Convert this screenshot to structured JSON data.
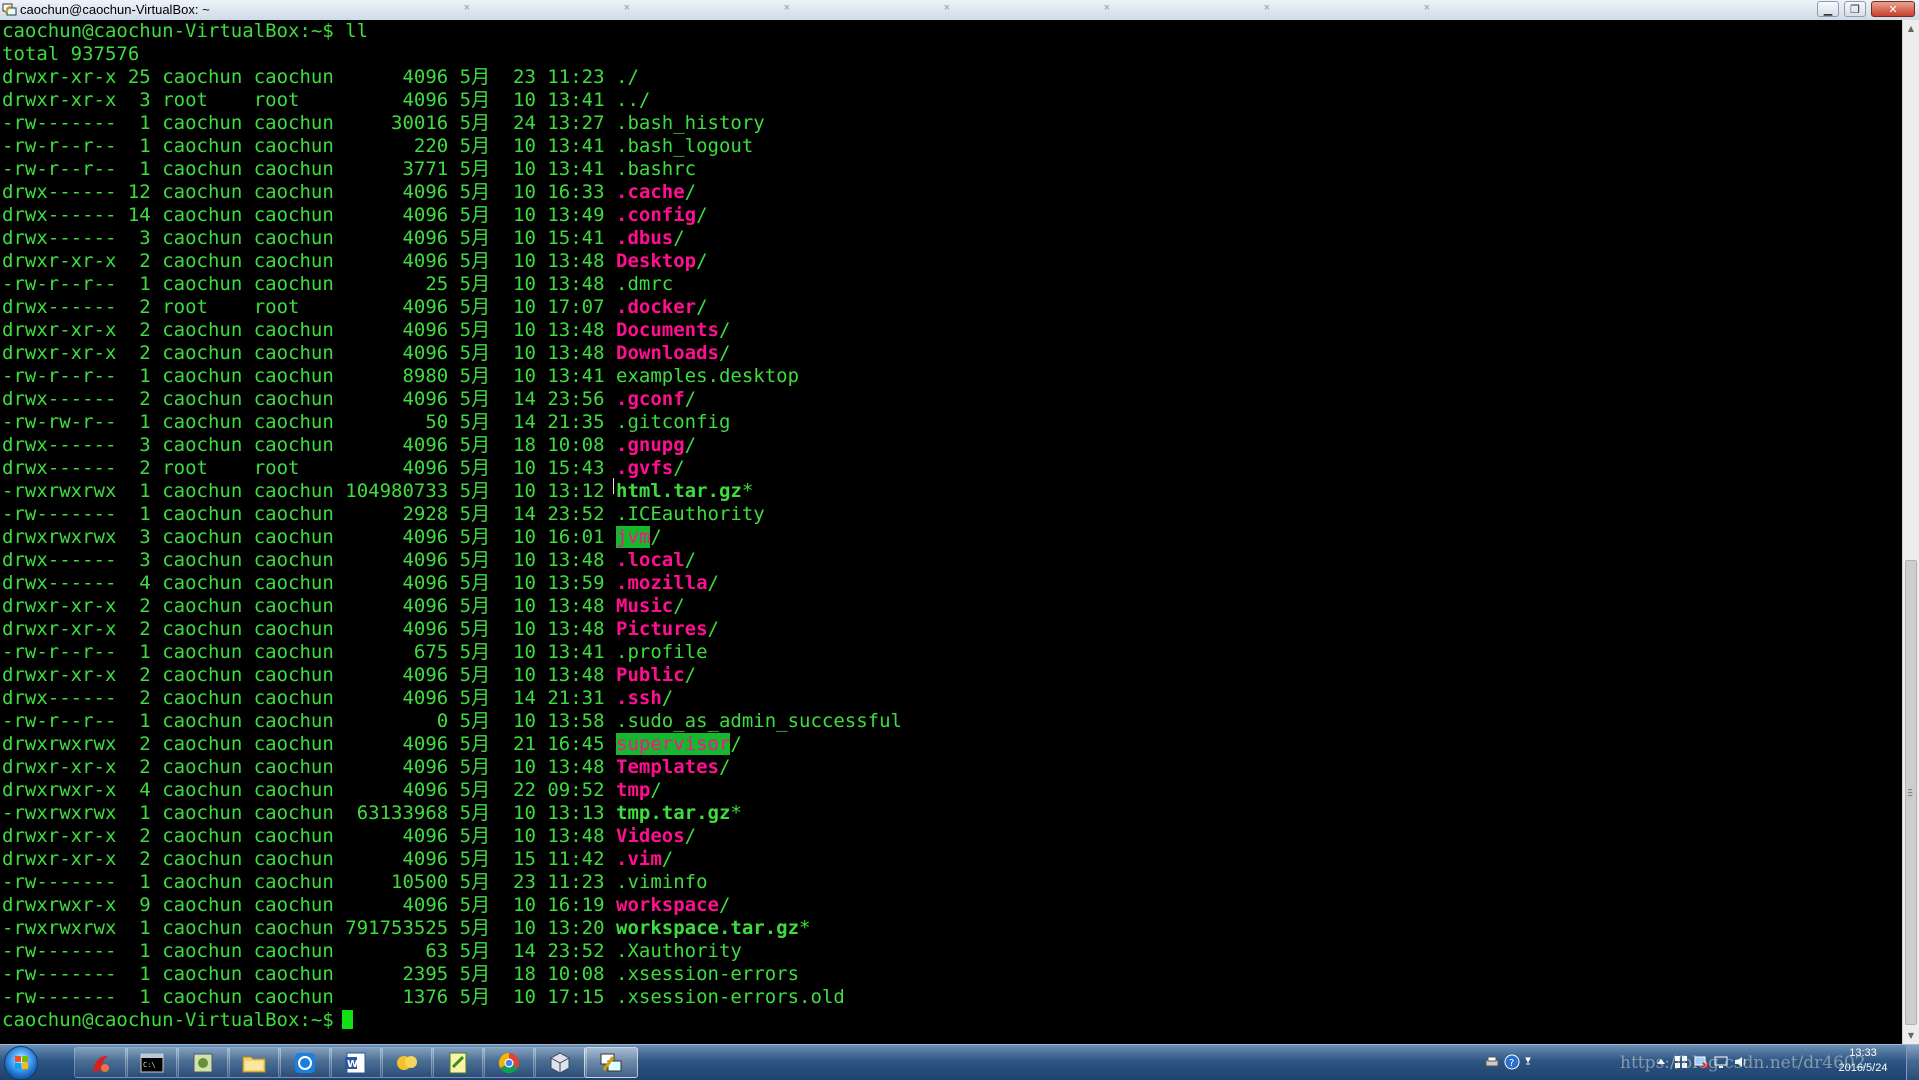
{
  "window": {
    "title": "caochun@caochun-VirtualBox: ~",
    "ghost_tabs": [
      "",
      ""
    ]
  },
  "terminal": {
    "prompt": "caochun@caochun-VirtualBox:~$",
    "command": "ll",
    "total_line": "total 937576",
    "entries": [
      {
        "perm": "drwxr-xr-x",
        "links": "25",
        "user": "caochun",
        "group": "caochun",
        "size": "4096",
        "month": "5月",
        "day": "23",
        "time": "11:23",
        "name": ".",
        "suffix": "/",
        "type": "plain"
      },
      {
        "perm": "drwxr-xr-x",
        "links": "3",
        "user": "root",
        "group": "root",
        "size": "4096",
        "month": "5月",
        "day": "10",
        "time": "13:41",
        "name": "..",
        "suffix": "/",
        "type": "plain"
      },
      {
        "perm": "-rw-------",
        "links": "1",
        "user": "caochun",
        "group": "caochun",
        "size": "30016",
        "month": "5月",
        "day": "24",
        "time": "13:27",
        "name": ".bash_history",
        "suffix": "",
        "type": "plain"
      },
      {
        "perm": "-rw-r--r--",
        "links": "1",
        "user": "caochun",
        "group": "caochun",
        "size": "220",
        "month": "5月",
        "day": "10",
        "time": "13:41",
        "name": ".bash_logout",
        "suffix": "",
        "type": "plain"
      },
      {
        "perm": "-rw-r--r--",
        "links": "1",
        "user": "caochun",
        "group": "caochun",
        "size": "3771",
        "month": "5月",
        "day": "10",
        "time": "13:41",
        "name": ".bashrc",
        "suffix": "",
        "type": "plain"
      },
      {
        "perm": "drwx------",
        "links": "12",
        "user": "caochun",
        "group": "caochun",
        "size": "4096",
        "month": "5月",
        "day": "10",
        "time": "16:33",
        "name": ".cache",
        "suffix": "/",
        "type": "dir"
      },
      {
        "perm": "drwx------",
        "links": "14",
        "user": "caochun",
        "group": "caochun",
        "size": "4096",
        "month": "5月",
        "day": "10",
        "time": "13:49",
        "name": ".config",
        "suffix": "/",
        "type": "dir"
      },
      {
        "perm": "drwx------",
        "links": "3",
        "user": "caochun",
        "group": "caochun",
        "size": "4096",
        "month": "5月",
        "day": "10",
        "time": "15:41",
        "name": ".dbus",
        "suffix": "/",
        "type": "dir"
      },
      {
        "perm": "drwxr-xr-x",
        "links": "2",
        "user": "caochun",
        "group": "caochun",
        "size": "4096",
        "month": "5月",
        "day": "10",
        "time": "13:48",
        "name": "Desktop",
        "suffix": "/",
        "type": "dir"
      },
      {
        "perm": "-rw-r--r--",
        "links": "1",
        "user": "caochun",
        "group": "caochun",
        "size": "25",
        "month": "5月",
        "day": "10",
        "time": "13:48",
        "name": ".dmrc",
        "suffix": "",
        "type": "plain"
      },
      {
        "perm": "drwx------",
        "links": "2",
        "user": "root",
        "group": "root",
        "size": "4096",
        "month": "5月",
        "day": "10",
        "time": "17:07",
        "name": ".docker",
        "suffix": "/",
        "type": "dir"
      },
      {
        "perm": "drwxr-xr-x",
        "links": "2",
        "user": "caochun",
        "group": "caochun",
        "size": "4096",
        "month": "5月",
        "day": "10",
        "time": "13:48",
        "name": "Documents",
        "suffix": "/",
        "type": "dir"
      },
      {
        "perm": "drwxr-xr-x",
        "links": "2",
        "user": "caochun",
        "group": "caochun",
        "size": "4096",
        "month": "5月",
        "day": "10",
        "time": "13:48",
        "name": "Downloads",
        "suffix": "/",
        "type": "dir"
      },
      {
        "perm": "-rw-r--r--",
        "links": "1",
        "user": "caochun",
        "group": "caochun",
        "size": "8980",
        "month": "5月",
        "day": "10",
        "time": "13:41",
        "name": "examples.desktop",
        "suffix": "",
        "type": "plain"
      },
      {
        "perm": "drwx------",
        "links": "2",
        "user": "caochun",
        "group": "caochun",
        "size": "4096",
        "month": "5月",
        "day": "14",
        "time": "23:56",
        "name": ".gconf",
        "suffix": "/",
        "type": "dir"
      },
      {
        "perm": "-rw-rw-r--",
        "links": "1",
        "user": "caochun",
        "group": "caochun",
        "size": "50",
        "month": "5月",
        "day": "14",
        "time": "21:35",
        "name": ".gitconfig",
        "suffix": "",
        "type": "plain"
      },
      {
        "perm": "drwx------",
        "links": "3",
        "user": "caochun",
        "group": "caochun",
        "size": "4096",
        "month": "5月",
        "day": "18",
        "time": "10:08",
        "name": ".gnupg",
        "suffix": "/",
        "type": "dir"
      },
      {
        "perm": "drwx------",
        "links": "2",
        "user": "root",
        "group": "root",
        "size": "4096",
        "month": "5月",
        "day": "10",
        "time": "15:43",
        "name": ".gvfs",
        "suffix": "/",
        "type": "dir"
      },
      {
        "perm": "-rwxrwxrwx",
        "links": "1",
        "user": "caochun",
        "group": "caochun",
        "size": "104980733",
        "month": "5月",
        "day": "10",
        "time": "13:12",
        "name": "html.tar.gz",
        "suffix": "*",
        "type": "exec"
      },
      {
        "perm": "-rw-------",
        "links": "1",
        "user": "caochun",
        "group": "caochun",
        "size": "2928",
        "month": "5月",
        "day": "14",
        "time": "23:52",
        "name": ".ICEauthority",
        "suffix": "",
        "type": "plain"
      },
      {
        "perm": "drwxrwxrwx",
        "links": "3",
        "user": "caochun",
        "group": "caochun",
        "size": "4096",
        "month": "5月",
        "day": "10",
        "time": "16:01",
        "name": "jvm",
        "suffix": "/",
        "type": "hl"
      },
      {
        "perm": "drwx------",
        "links": "3",
        "user": "caochun",
        "group": "caochun",
        "size": "4096",
        "month": "5月",
        "day": "10",
        "time": "13:48",
        "name": ".local",
        "suffix": "/",
        "type": "dir"
      },
      {
        "perm": "drwx------",
        "links": "4",
        "user": "caochun",
        "group": "caochun",
        "size": "4096",
        "month": "5月",
        "day": "10",
        "time": "13:59",
        "name": ".mozilla",
        "suffix": "/",
        "type": "dir"
      },
      {
        "perm": "drwxr-xr-x",
        "links": "2",
        "user": "caochun",
        "group": "caochun",
        "size": "4096",
        "month": "5月",
        "day": "10",
        "time": "13:48",
        "name": "Music",
        "suffix": "/",
        "type": "dir"
      },
      {
        "perm": "drwxr-xr-x",
        "links": "2",
        "user": "caochun",
        "group": "caochun",
        "size": "4096",
        "month": "5月",
        "day": "10",
        "time": "13:48",
        "name": "Pictures",
        "suffix": "/",
        "type": "dir"
      },
      {
        "perm": "-rw-r--r--",
        "links": "1",
        "user": "caochun",
        "group": "caochun",
        "size": "675",
        "month": "5月",
        "day": "10",
        "time": "13:41",
        "name": ".profile",
        "suffix": "",
        "type": "plain"
      },
      {
        "perm": "drwxr-xr-x",
        "links": "2",
        "user": "caochun",
        "group": "caochun",
        "size": "4096",
        "month": "5月",
        "day": "10",
        "time": "13:48",
        "name": "Public",
        "suffix": "/",
        "type": "dir"
      },
      {
        "perm": "drwx------",
        "links": "2",
        "user": "caochun",
        "group": "caochun",
        "size": "4096",
        "month": "5月",
        "day": "14",
        "time": "21:31",
        "name": ".ssh",
        "suffix": "/",
        "type": "dir"
      },
      {
        "perm": "-rw-r--r--",
        "links": "1",
        "user": "caochun",
        "group": "caochun",
        "size": "0",
        "month": "5月",
        "day": "10",
        "time": "13:58",
        "name": ".sudo_as_admin_successful",
        "suffix": "",
        "type": "plain"
      },
      {
        "perm": "drwxrwxrwx",
        "links": "2",
        "user": "caochun",
        "group": "caochun",
        "size": "4096",
        "month": "5月",
        "day": "21",
        "time": "16:45",
        "name": "supervisor",
        "suffix": "/",
        "type": "hl"
      },
      {
        "perm": "drwxr-xr-x",
        "links": "2",
        "user": "caochun",
        "group": "caochun",
        "size": "4096",
        "month": "5月",
        "day": "10",
        "time": "13:48",
        "name": "Templates",
        "suffix": "/",
        "type": "dir"
      },
      {
        "perm": "drwxrwxr-x",
        "links": "4",
        "user": "caochun",
        "group": "caochun",
        "size": "4096",
        "month": "5月",
        "day": "22",
        "time": "09:52",
        "name": "tmp",
        "suffix": "/",
        "type": "dir"
      },
      {
        "perm": "-rwxrwxrwx",
        "links": "1",
        "user": "caochun",
        "group": "caochun",
        "size": "63133968",
        "month": "5月",
        "day": "10",
        "time": "13:13",
        "name": "tmp.tar.gz",
        "suffix": "*",
        "type": "exec"
      },
      {
        "perm": "drwxr-xr-x",
        "links": "2",
        "user": "caochun",
        "group": "caochun",
        "size": "4096",
        "month": "5月",
        "day": "10",
        "time": "13:48",
        "name": "Videos",
        "suffix": "/",
        "type": "dir"
      },
      {
        "perm": "drwxr-xr-x",
        "links": "2",
        "user": "caochun",
        "group": "caochun",
        "size": "4096",
        "month": "5月",
        "day": "15",
        "time": "11:42",
        "name": ".vim",
        "suffix": "/",
        "type": "dir"
      },
      {
        "perm": "-rw-------",
        "links": "1",
        "user": "caochun",
        "group": "caochun",
        "size": "10500",
        "month": "5月",
        "day": "23",
        "time": "11:23",
        "name": ".viminfo",
        "suffix": "",
        "type": "plain"
      },
      {
        "perm": "drwxrwxr-x",
        "links": "9",
        "user": "caochun",
        "group": "caochun",
        "size": "4096",
        "month": "5月",
        "day": "10",
        "time": "16:19",
        "name": "workspace",
        "suffix": "/",
        "type": "dir"
      },
      {
        "perm": "-rwxrwxrwx",
        "links": "1",
        "user": "caochun",
        "group": "caochun",
        "size": "791753525",
        "month": "5月",
        "day": "10",
        "time": "13:20",
        "name": "workspace.tar.gz",
        "suffix": "*",
        "type": "exec"
      },
      {
        "perm": "-rw-------",
        "links": "1",
        "user": "caochun",
        "group": "caochun",
        "size": "63",
        "month": "5月",
        "day": "14",
        "time": "23:52",
        "name": ".Xauthority",
        "suffix": "",
        "type": "plain"
      },
      {
        "perm": "-rw-------",
        "links": "1",
        "user": "caochun",
        "group": "caochun",
        "size": "2395",
        "month": "5月",
        "day": "18",
        "time": "10:08",
        "name": ".xsession-errors",
        "suffix": "",
        "type": "plain"
      },
      {
        "perm": "-rw-------",
        "links": "1",
        "user": "caochun",
        "group": "caochun",
        "size": "1376",
        "month": "5月",
        "day": "10",
        "time": "17:15",
        "name": ".xsession-errors.old",
        "suffix": "",
        "type": "plain"
      }
    ]
  },
  "colors": {
    "terminal_bg": "#000000",
    "text_green": "#3fdc3f",
    "dir_magenta": "#ff0f8f",
    "highlight_bg": "#13b82d"
  },
  "taskbar": {
    "apps": [
      {
        "id": "foxit",
        "icon": "pdf-reader-icon"
      },
      {
        "id": "cmd",
        "icon": "command-prompt-icon"
      },
      {
        "id": "app3",
        "icon": "application-icon"
      },
      {
        "id": "explorer",
        "icon": "folder-icon"
      },
      {
        "id": "qq-browser",
        "icon": "browser-icon"
      },
      {
        "id": "word",
        "icon": "word-icon"
      },
      {
        "id": "app7",
        "icon": "chat-icon"
      },
      {
        "id": "notepad",
        "icon": "notepad-icon"
      },
      {
        "id": "chrome",
        "icon": "chrome-icon"
      },
      {
        "id": "virtualbox",
        "icon": "virtualbox-icon"
      },
      {
        "id": "putty",
        "icon": "putty-icon"
      }
    ],
    "watermark": "https://blog.csdn.net/dr4602",
    "clock_time": "13:33",
    "clock_date": "2016/5/24"
  }
}
